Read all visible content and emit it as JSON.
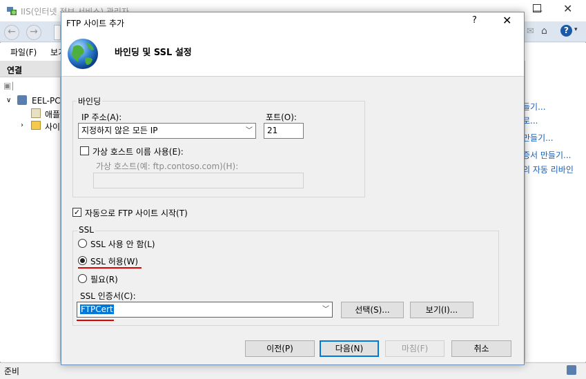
{
  "main_window": {
    "title": "IIS(인터넷 정보 서비스) 관리자",
    "menu": [
      "파일(F)",
      "보기"
    ],
    "connections_title": "연결",
    "tree": {
      "server": "EEL-PC(",
      "child1": "애플",
      "child2": "사이"
    },
    "actions": [
      "들기...",
      "로...",
      "만들기...",
      "증서 만들기...",
      "의 자동 리바인"
    ],
    "status": "준비"
  },
  "dialog": {
    "title": "FTP 사이트 추가",
    "help": "?",
    "close": "✕",
    "heading": "바인딩 및 SSL 설정",
    "binding": {
      "group_label": "바인딩",
      "ip_label": "IP 주소(A):",
      "ip_value": "지정하지 않은 모든 IP",
      "port_label": "포트(O):",
      "port_value": "21",
      "vhost_checkbox": "가상 호스트 이름 사용(E):",
      "vhost_label": "가상 호스트(예: ftp.contoso.com)(H):",
      "vhost_value": ""
    },
    "autostart_label": "자동으로 FTP 사이트 시작(T)",
    "ssl": {
      "group_label": "SSL",
      "option_none": "SSL 사용 안 함(L)",
      "option_allow": "SSL 허용(W)",
      "option_require": "필요(R)",
      "cert_label": "SSL 인증서(C):",
      "cert_value": "FTPCert",
      "select_button": "선택(S)...",
      "view_button": "보기(I)..."
    },
    "buttons": {
      "prev": "이전(P)",
      "next": "다음(N)",
      "finish": "마침(F)",
      "cancel": "취소"
    }
  }
}
